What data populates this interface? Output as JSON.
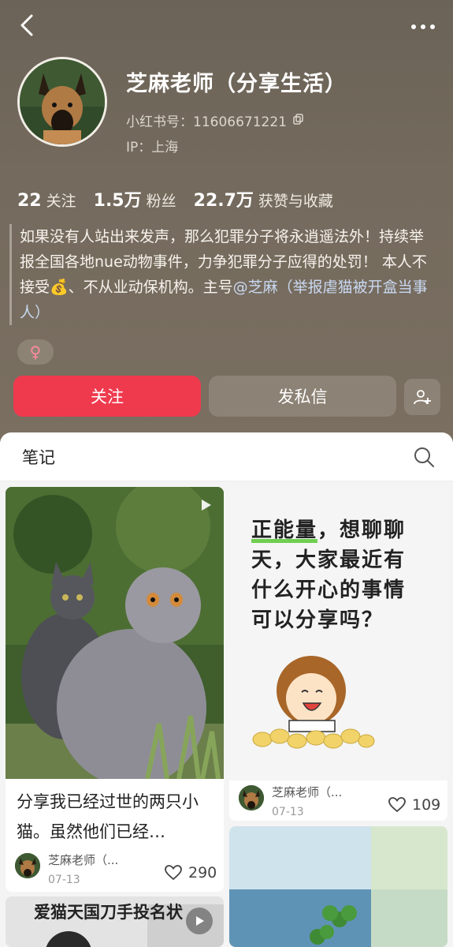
{
  "profile": {
    "name": "芝麻老师（分享生活）",
    "id_label": "小红书号：11606671221",
    "ip_label": "IP：上海"
  },
  "stats": [
    {
      "value": "22",
      "label": "关注"
    },
    {
      "value": "1.5万",
      "label": "粉丝"
    },
    {
      "value": "22.7万",
      "label": "获赞与收藏"
    }
  ],
  "bio": {
    "text": "如果没有人站出来发声，那么犯罪分子将永逍遥法外！持续举报全国各地nue动物事件，力争犯罪分子应得的处罚！ 本人不接受💰、不从业动保机构。主号",
    "mention": "@芝麻（举报虐猫被开盒当事人）"
  },
  "gender": "♀",
  "actions": {
    "follow_label": "关注",
    "message_label": "发私信"
  },
  "tabs": {
    "notes_label": "笔记"
  },
  "notes": [
    {
      "title": "分享我已经过世的两只小猫。虽然他们已经…",
      "author": "芝麻老师（...",
      "date": "07-13",
      "likes": "290"
    },
    {
      "cover_text_highlight": "正能量",
      "cover_text_rest": "，想聊聊天，大家最近有什么开心的事情可以分享吗？",
      "author": "芝麻老师（...",
      "date": "07-13",
      "likes": "109"
    },
    {
      "cover_caption": "爱猫天国刀手投名状"
    }
  ],
  "colors": {
    "accent": "#ef3a4e",
    "header_bg": "#746a5d"
  }
}
